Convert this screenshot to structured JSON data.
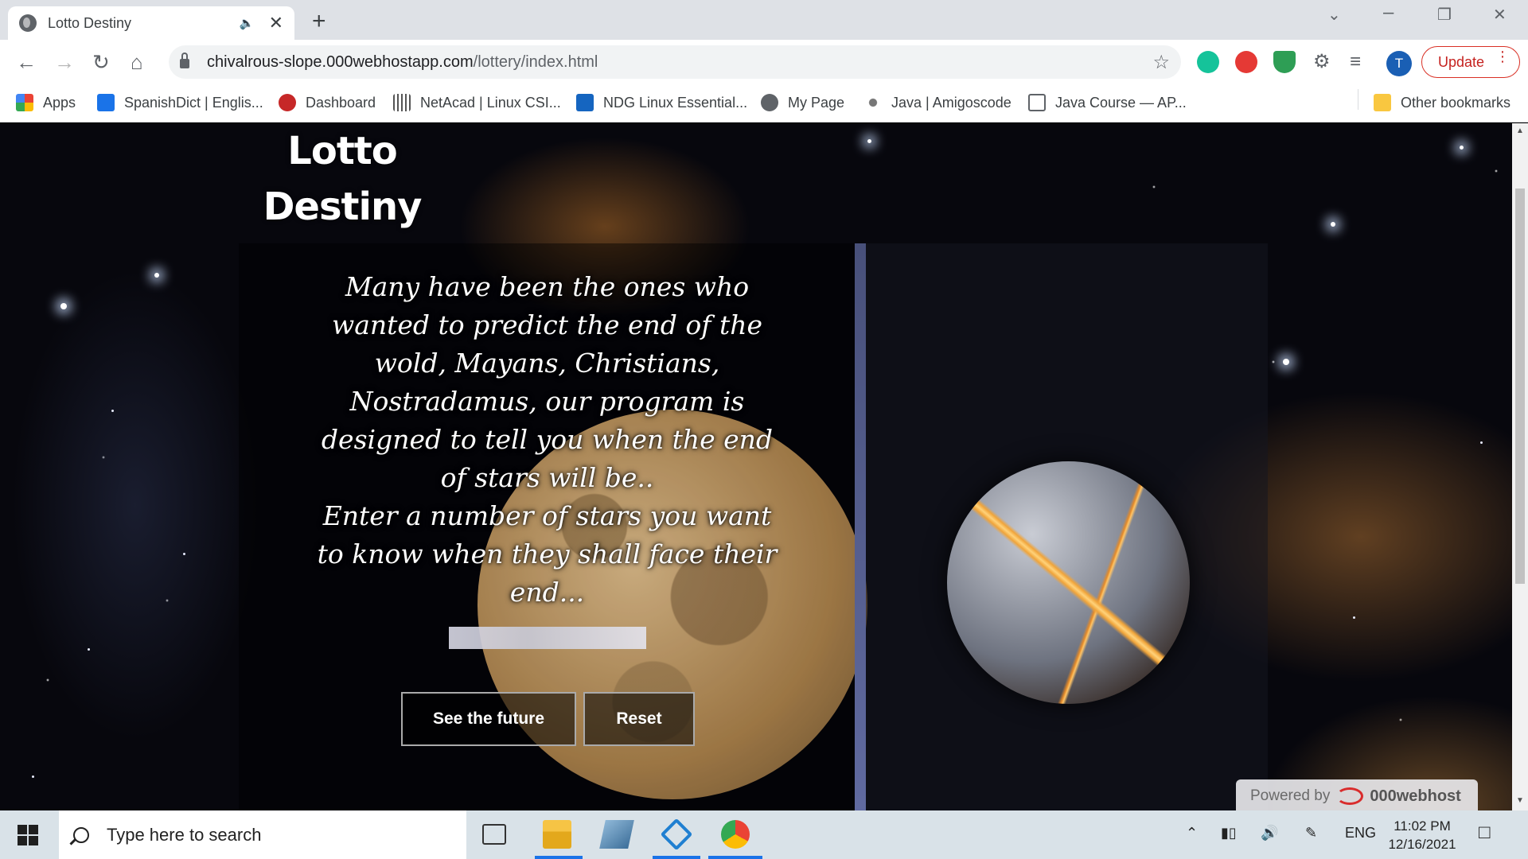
{
  "browser": {
    "tab": {
      "title": "Lotto Destiny"
    },
    "address": {
      "host": "chivalrous-slope.000webhostapp.com",
      "path": "/lottery/index.html"
    },
    "profile_initial": "T",
    "update_label": "Update",
    "bookmarks": [
      {
        "label": "Apps",
        "icon": "apps-grid-icon",
        "color": "#1a73e8"
      },
      {
        "label": "SpanishDict | Englis...",
        "icon": "spanishdict-icon",
        "color": "#1a73e8"
      },
      {
        "label": "Dashboard",
        "icon": "dashboard-icon",
        "color": "#c62828"
      },
      {
        "label": "NetAcad | Linux CSI...",
        "icon": "cisco-icon",
        "color": "#555555"
      },
      {
        "label": "NDG Linux Essential...",
        "icon": "ndg-icon",
        "color": "#1565c0"
      },
      {
        "label": "My Page",
        "icon": "globe-icon",
        "color": "#5f6368"
      },
      {
        "label": "Java | Amigoscode",
        "icon": "amigoscode-icon",
        "color": "#777777"
      },
      {
        "label": "Java Course — AP...",
        "icon": "doc-icon",
        "color": "#5f6368"
      }
    ],
    "other_bookmarks": "Other bookmarks"
  },
  "page": {
    "title_line1": "Lotto",
    "title_line2": "Destiny",
    "story": "Many have been the ones who wanted to predict the end of the wold, Mayans, Christians, Nostradamus, our program is designed to tell you when the end of stars will be..",
    "prompt": "Enter a number of stars you want to know when they shall face their end...",
    "input": {
      "value": "",
      "placeholder": ""
    },
    "buttons": {
      "future": "See the future",
      "reset": "Reset"
    },
    "powered_by": {
      "label": "Powered by",
      "brand": "000webhost"
    }
  },
  "taskbar": {
    "search_placeholder": "Type here to search",
    "language": "ENG",
    "time": "11:02 PM",
    "date": "12/16/2021"
  }
}
